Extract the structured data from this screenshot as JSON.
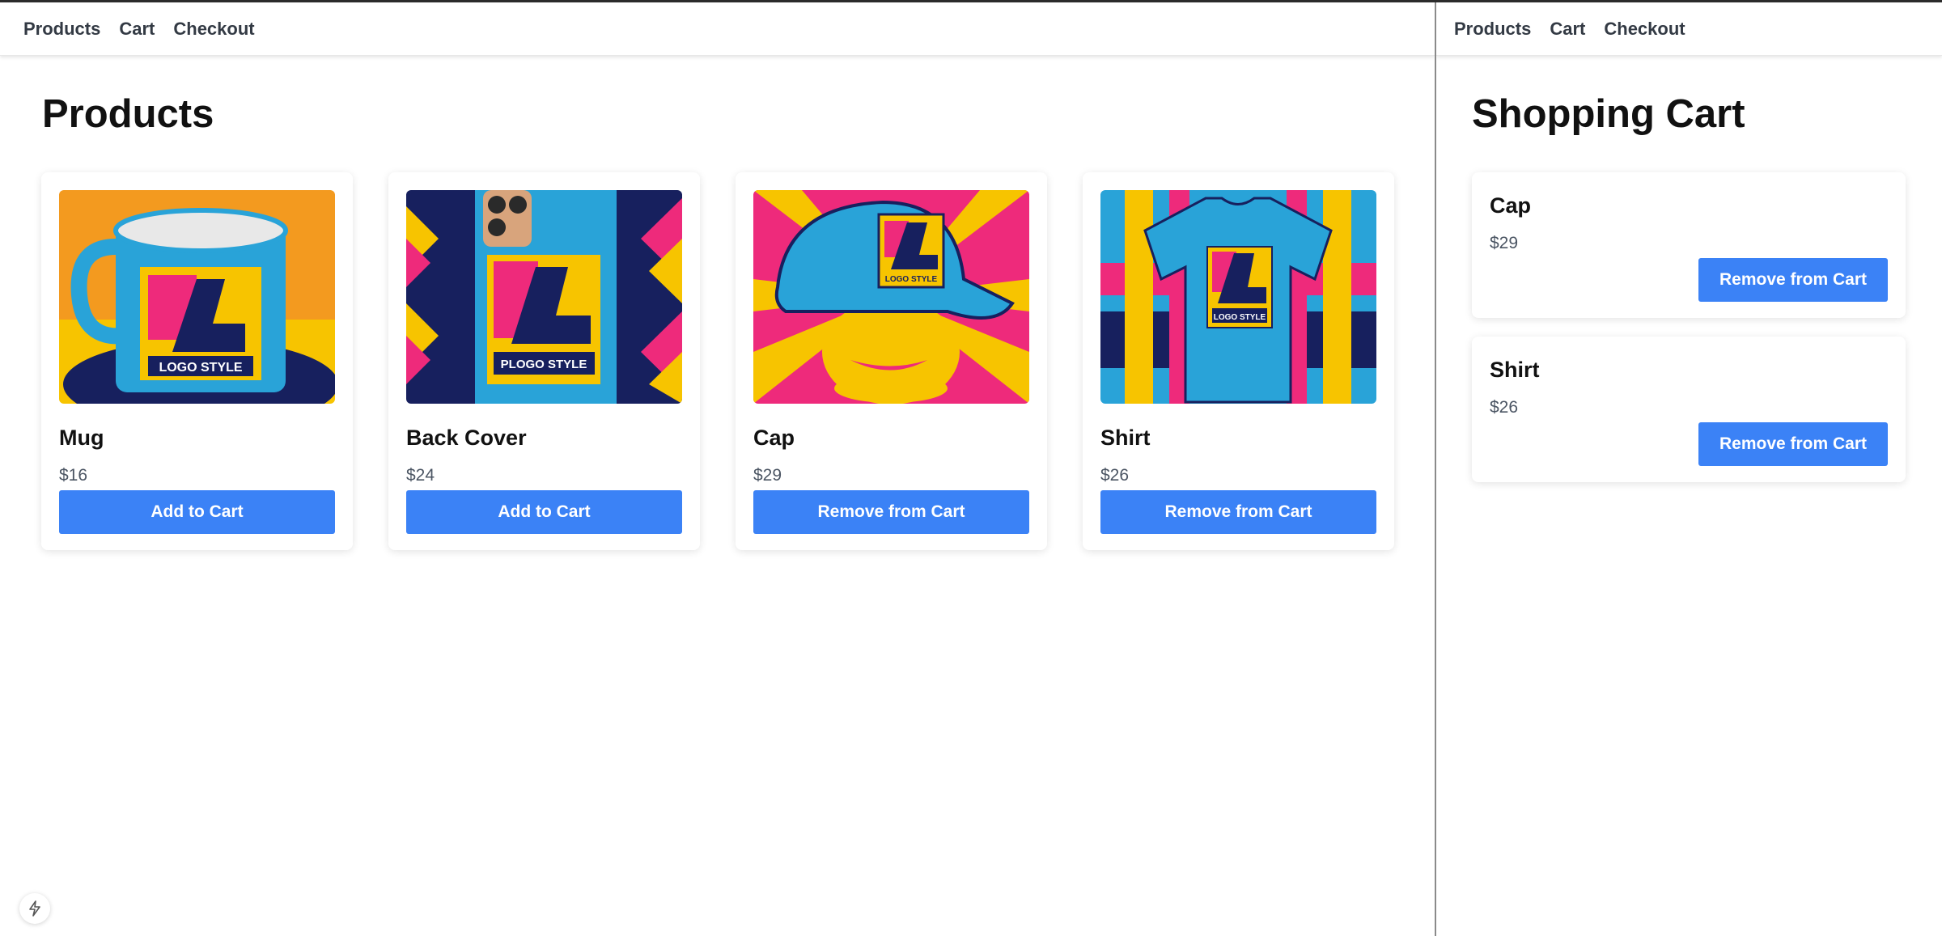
{
  "left_pane": {
    "nav": {
      "products": "Products",
      "cart": "Cart",
      "checkout": "Checkout"
    },
    "title": "Products",
    "products": [
      {
        "name": "Mug",
        "price": "$16",
        "button": "Add to Cart",
        "image_logo_text": "LOGO STYLE"
      },
      {
        "name": "Back Cover",
        "price": "$24",
        "button": "Add to Cart",
        "image_logo_text": "PLOGO STYLE"
      },
      {
        "name": "Cap",
        "price": "$29",
        "button": "Remove from Cart",
        "image_logo_text": "LOGO STYLE"
      },
      {
        "name": "Shirt",
        "price": "$26",
        "button": "Remove from Cart",
        "image_logo_text": "LOGO STYLE"
      }
    ]
  },
  "right_pane": {
    "nav": {
      "products": "Products",
      "cart": "Cart",
      "checkout": "Checkout"
    },
    "title": "Shopping Cart",
    "items": [
      {
        "name": "Cap",
        "price": "$29",
        "button": "Remove from Cart"
      },
      {
        "name": "Shirt",
        "price": "$26",
        "button": "Remove from Cart"
      }
    ]
  },
  "dev_badge_icon": "lightning-bolt-icon",
  "colors": {
    "accent": "#3b82f6",
    "text": "#111111",
    "muted": "#4b5563",
    "nav_text": "#333a44",
    "product_blue": "#29a3d8",
    "product_yellow": "#f7c400",
    "product_pink": "#ee2a7b",
    "product_navy": "#17205e",
    "product_orange": "#f39a1f"
  }
}
